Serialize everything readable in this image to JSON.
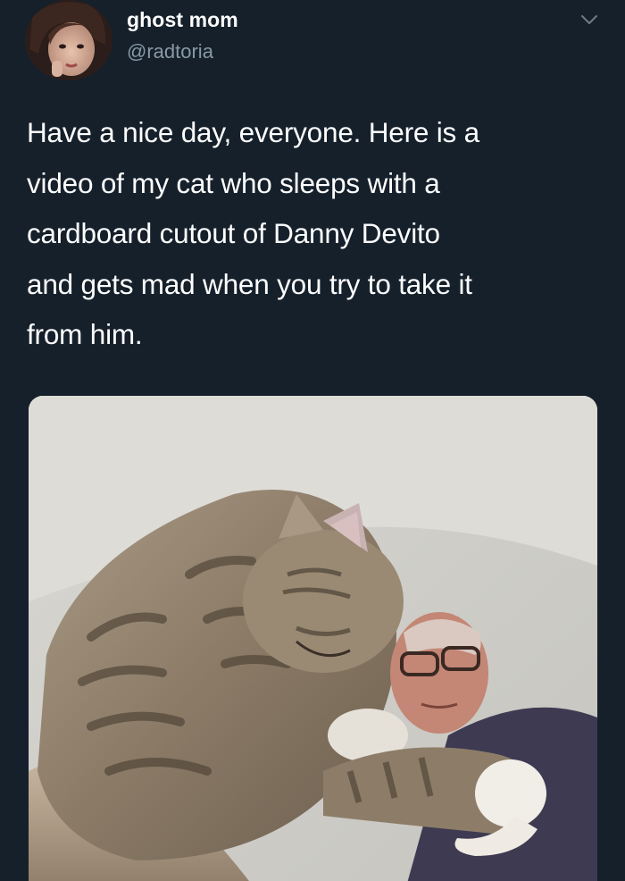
{
  "user": {
    "display_name": "ghost mom",
    "handle": "@radtoria",
    "avatar_icon": "profile-photo"
  },
  "tweet": {
    "text": "Have a nice day, everyone. Here is a\nvideo of my cat who sleeps with a\ncardboard cutout of Danny Devito\nand gets mad when you try to take it\nfrom him."
  },
  "menu": {
    "icon": "chevron-down-icon"
  },
  "media": {
    "type": "photo"
  },
  "colors": {
    "background": "#15202b",
    "text": "#ffffff",
    "secondary_text": "#8899a6"
  }
}
